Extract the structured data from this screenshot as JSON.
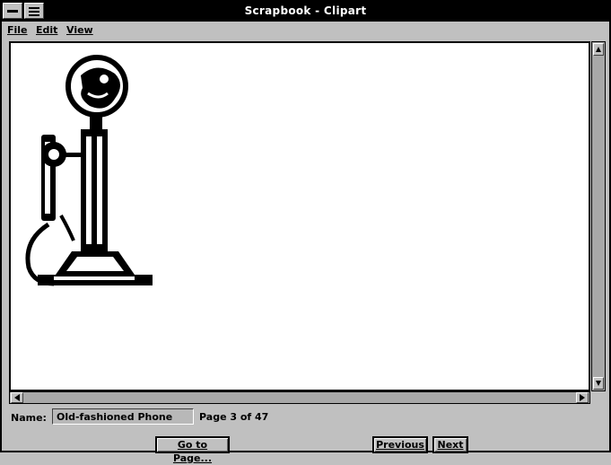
{
  "window": {
    "title": "Scrapbook - Clipart"
  },
  "menu": {
    "items": [
      "File",
      "Edit",
      "View"
    ]
  },
  "clip": {
    "name_label": "Name:",
    "name_value": "Old-fashioned Phone",
    "page_info": "Page 3 of 47"
  },
  "buttons": {
    "goto": "Go to Page...",
    "previous": "Previous",
    "next": "Next"
  },
  "icons": {
    "system_menu": "minimize-bar-icon",
    "window_menu": "window-menu-icon",
    "clipart": "candlestick-telephone-icon"
  }
}
